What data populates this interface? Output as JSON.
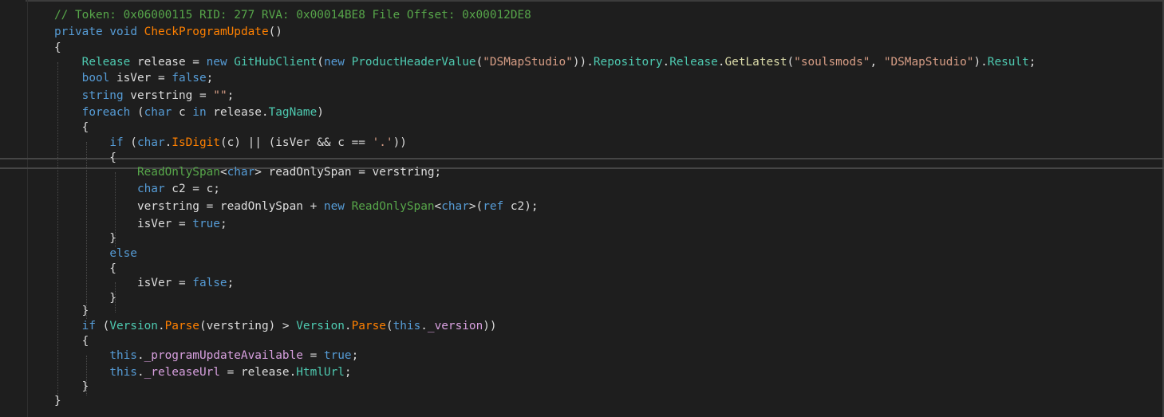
{
  "editor": {
    "lines": [
      [
        {
          "t": "// Token: 0x06000115 RID: 277 RVA: 0x00014BE8 File Offset: 0x00012DE8",
          "c": "comment"
        }
      ],
      [
        {
          "t": "private",
          "c": "kw"
        },
        {
          "t": " ",
          "c": "plain"
        },
        {
          "t": "void",
          "c": "kw"
        },
        {
          "t": " ",
          "c": "plain"
        },
        {
          "t": "CheckProgramUpdate",
          "c": "fn"
        },
        {
          "t": "()",
          "c": "plain"
        }
      ],
      [
        {
          "t": "{",
          "c": "plain"
        }
      ],
      [
        {
          "t": "    ",
          "c": "plain"
        },
        {
          "t": "Release",
          "c": "type"
        },
        {
          "t": " release = ",
          "c": "plain"
        },
        {
          "t": "new",
          "c": "kw"
        },
        {
          "t": " ",
          "c": "plain"
        },
        {
          "t": "GitHubClient",
          "c": "type"
        },
        {
          "t": "(",
          "c": "plain"
        },
        {
          "t": "new",
          "c": "kw"
        },
        {
          "t": " ",
          "c": "plain"
        },
        {
          "t": "ProductHeaderValue",
          "c": "type"
        },
        {
          "t": "(",
          "c": "plain"
        },
        {
          "t": "\"DSMapStudio\"",
          "c": "string"
        },
        {
          "t": ")).",
          "c": "plain"
        },
        {
          "t": "Repository",
          "c": "member-prop"
        },
        {
          "t": ".",
          "c": "plain"
        },
        {
          "t": "Release",
          "c": "member-prop"
        },
        {
          "t": ".",
          "c": "plain"
        },
        {
          "t": "GetLatest",
          "c": "method"
        },
        {
          "t": "(",
          "c": "plain"
        },
        {
          "t": "\"soulsmods\"",
          "c": "string"
        },
        {
          "t": ", ",
          "c": "plain"
        },
        {
          "t": "\"DSMapStudio\"",
          "c": "string"
        },
        {
          "t": ").",
          "c": "plain"
        },
        {
          "t": "Result",
          "c": "member-prop"
        },
        {
          "t": ";",
          "c": "plain"
        }
      ],
      [
        {
          "t": "    ",
          "c": "plain"
        },
        {
          "t": "bool",
          "c": "kw"
        },
        {
          "t": " isVer = ",
          "c": "plain"
        },
        {
          "t": "false",
          "c": "kw"
        },
        {
          "t": ";",
          "c": "plain"
        }
      ],
      [
        {
          "t": "    ",
          "c": "plain"
        },
        {
          "t": "string",
          "c": "kw"
        },
        {
          "t": " verstring = ",
          "c": "plain"
        },
        {
          "t": "\"\"",
          "c": "string"
        },
        {
          "t": ";",
          "c": "plain"
        }
      ],
      [
        {
          "t": "    ",
          "c": "plain"
        },
        {
          "t": "foreach",
          "c": "kw"
        },
        {
          "t": " (",
          "c": "plain"
        },
        {
          "t": "char",
          "c": "kw"
        },
        {
          "t": " c ",
          "c": "plain"
        },
        {
          "t": "in",
          "c": "kw"
        },
        {
          "t": " release.",
          "c": "plain"
        },
        {
          "t": "TagName",
          "c": "member-prop"
        },
        {
          "t": ")",
          "c": "plain"
        }
      ],
      [
        {
          "t": "    {",
          "c": "plain"
        }
      ],
      [
        {
          "t": "        ",
          "c": "plain"
        },
        {
          "t": "if",
          "c": "kw"
        },
        {
          "t": " (",
          "c": "plain"
        },
        {
          "t": "char",
          "c": "kw"
        },
        {
          "t": ".",
          "c": "plain"
        },
        {
          "t": "IsDigit",
          "c": "fn"
        },
        {
          "t": "(c) || (isVer && c == ",
          "c": "plain"
        },
        {
          "t": "'.'",
          "c": "string"
        },
        {
          "t": "))",
          "c": "plain"
        }
      ],
      [
        {
          "t": "        {",
          "c": "plain"
        }
      ],
      [
        {
          "t": "            ",
          "c": "plain"
        },
        {
          "t": "ReadOnlySpan",
          "c": "comment"
        },
        {
          "t": "<",
          "c": "plain"
        },
        {
          "t": "char",
          "c": "kw"
        },
        {
          "t": "> readOnlySpan = verstring;",
          "c": "plain"
        }
      ],
      [
        {
          "t": "            ",
          "c": "plain"
        },
        {
          "t": "char",
          "c": "kw"
        },
        {
          "t": " c2 = c;",
          "c": "plain"
        }
      ],
      [
        {
          "t": "            verstring = readOnlySpan + ",
          "c": "plain"
        },
        {
          "t": "new",
          "c": "kw"
        },
        {
          "t": " ",
          "c": "plain"
        },
        {
          "t": "ReadOnlySpan",
          "c": "comment"
        },
        {
          "t": "<",
          "c": "plain"
        },
        {
          "t": "char",
          "c": "kw"
        },
        {
          "t": ">(",
          "c": "plain"
        },
        {
          "t": "ref",
          "c": "kw"
        },
        {
          "t": " c2);",
          "c": "plain"
        }
      ],
      [
        {
          "t": "            isVer = ",
          "c": "plain"
        },
        {
          "t": "true",
          "c": "kw"
        },
        {
          "t": ";",
          "c": "plain"
        }
      ],
      [
        {
          "t": "        }",
          "c": "plain"
        }
      ],
      [
        {
          "t": "        ",
          "c": "plain"
        },
        {
          "t": "else",
          "c": "kw"
        }
      ],
      [
        {
          "t": "        {",
          "c": "plain"
        }
      ],
      [
        {
          "t": "            isVer = ",
          "c": "plain"
        },
        {
          "t": "false",
          "c": "kw"
        },
        {
          "t": ";",
          "c": "plain"
        }
      ],
      [
        {
          "t": "        }",
          "c": "plain"
        }
      ],
      [
        {
          "t": "    }",
          "c": "plain"
        }
      ],
      [
        {
          "t": "    ",
          "c": "plain"
        },
        {
          "t": "if",
          "c": "kw"
        },
        {
          "t": " (",
          "c": "plain"
        },
        {
          "t": "Version",
          "c": "type"
        },
        {
          "t": ".",
          "c": "plain"
        },
        {
          "t": "Parse",
          "c": "fn"
        },
        {
          "t": "(verstring) > ",
          "c": "plain"
        },
        {
          "t": "Version",
          "c": "type"
        },
        {
          "t": ".",
          "c": "plain"
        },
        {
          "t": "Parse",
          "c": "fn"
        },
        {
          "t": "(",
          "c": "plain"
        },
        {
          "t": "this",
          "c": "kw"
        },
        {
          "t": ".",
          "c": "plain"
        },
        {
          "t": "_version",
          "c": "ctrl"
        },
        {
          "t": "))",
          "c": "plain"
        }
      ],
      [
        {
          "t": "    {",
          "c": "plain"
        }
      ],
      [
        {
          "t": "        ",
          "c": "plain"
        },
        {
          "t": "this",
          "c": "kw"
        },
        {
          "t": ".",
          "c": "plain"
        },
        {
          "t": "_programUpdateAvailable",
          "c": "ctrl"
        },
        {
          "t": " = ",
          "c": "plain"
        },
        {
          "t": "true",
          "c": "kw"
        },
        {
          "t": ";",
          "c": "plain"
        }
      ],
      [
        {
          "t": "        ",
          "c": "plain"
        },
        {
          "t": "this",
          "c": "kw"
        },
        {
          "t": ".",
          "c": "plain"
        },
        {
          "t": "_releaseUrl",
          "c": "ctrl"
        },
        {
          "t": " = release.",
          "c": "plain"
        },
        {
          "t": "HtmlUrl",
          "c": "member-prop"
        },
        {
          "t": ";",
          "c": "plain"
        }
      ],
      [
        {
          "t": "    }",
          "c": "plain"
        }
      ],
      [
        {
          "t": "}",
          "c": "plain"
        }
      ]
    ],
    "colors": {
      "background": "#1e1e1e",
      "comment": "#57a64a",
      "keyword": "#569cd6",
      "type": "#4ec9b0",
      "method": "#dcdcaa",
      "string": "#d69d85",
      "field": "#d8a0df",
      "function_name": "#ff8000"
    }
  }
}
